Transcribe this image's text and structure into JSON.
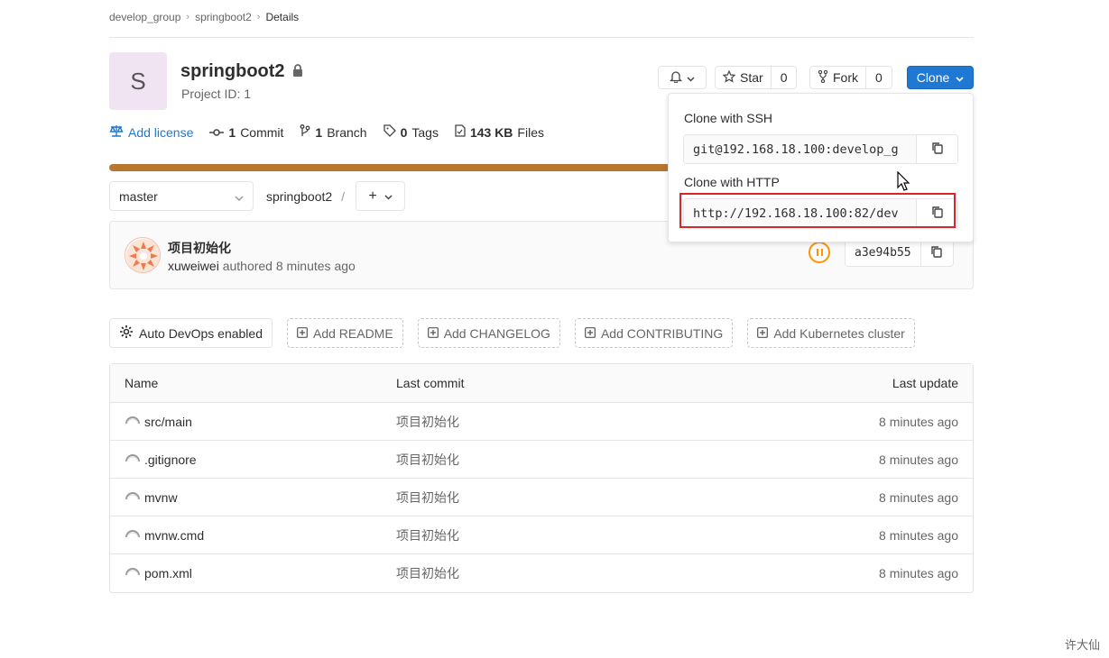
{
  "breadcrumb": {
    "group": "develop_group",
    "project": "springboot2",
    "current": "Details"
  },
  "project": {
    "avatar_letter": "S",
    "name": "springboot2",
    "id_text": "Project ID: 1",
    "lock_icon": "lock-icon"
  },
  "stats": {
    "license": "Add license",
    "commits_count": "1",
    "commits_label": "Commit",
    "branches_count": "1",
    "branches_label": "Branch",
    "tags_count": "0",
    "tags_label": "Tags",
    "files_size": "143 KB",
    "files_label": "Files"
  },
  "header_buttons": {
    "star_label": "Star",
    "star_count": "0",
    "fork_label": "Fork",
    "fork_count": "0",
    "clone_label": "Clone"
  },
  "repo": {
    "branch": "master",
    "path": "springboot2",
    "path_sep": "/",
    "plus": "+"
  },
  "last_commit": {
    "title": "项目初始化",
    "author": "xuweiwei",
    "meta": "authored 8 minutes ago",
    "sha": "a3e94b55",
    "pipeline_status": "paused"
  },
  "actions": [
    {
      "label": "Auto DevOps enabled"
    },
    {
      "label": "Add README"
    },
    {
      "label": "Add CHANGELOG"
    },
    {
      "label": "Add CONTRIBUTING"
    },
    {
      "label": "Add Kubernetes cluster"
    }
  ],
  "table": {
    "headers": {
      "name": "Name",
      "commit": "Last commit",
      "update": "Last update"
    },
    "rows": [
      {
        "name": "src/main",
        "commit": "项目初始化",
        "update": "8 minutes ago"
      },
      {
        "name": ".gitignore",
        "commit": "项目初始化",
        "update": "8 minutes ago"
      },
      {
        "name": "mvnw",
        "commit": "项目初始化",
        "update": "8 minutes ago"
      },
      {
        "name": "mvnw.cmd",
        "commit": "项目初始化",
        "update": "8 minutes ago"
      },
      {
        "name": "pom.xml",
        "commit": "项目初始化",
        "update": "8 minutes ago"
      }
    ]
  },
  "clone_dropdown": {
    "ssh_label": "Clone with SSH",
    "ssh_url": "git@192.168.18.100:develop_g",
    "http_label": "Clone with HTTP",
    "http_url": "http://192.168.18.100:82/dev"
  },
  "watermark": "许大仙",
  "colors": {
    "accent": "#1f78d1",
    "progress": "#b8762e",
    "pipeline": "#fc9403",
    "highlight": "#d9242b"
  }
}
